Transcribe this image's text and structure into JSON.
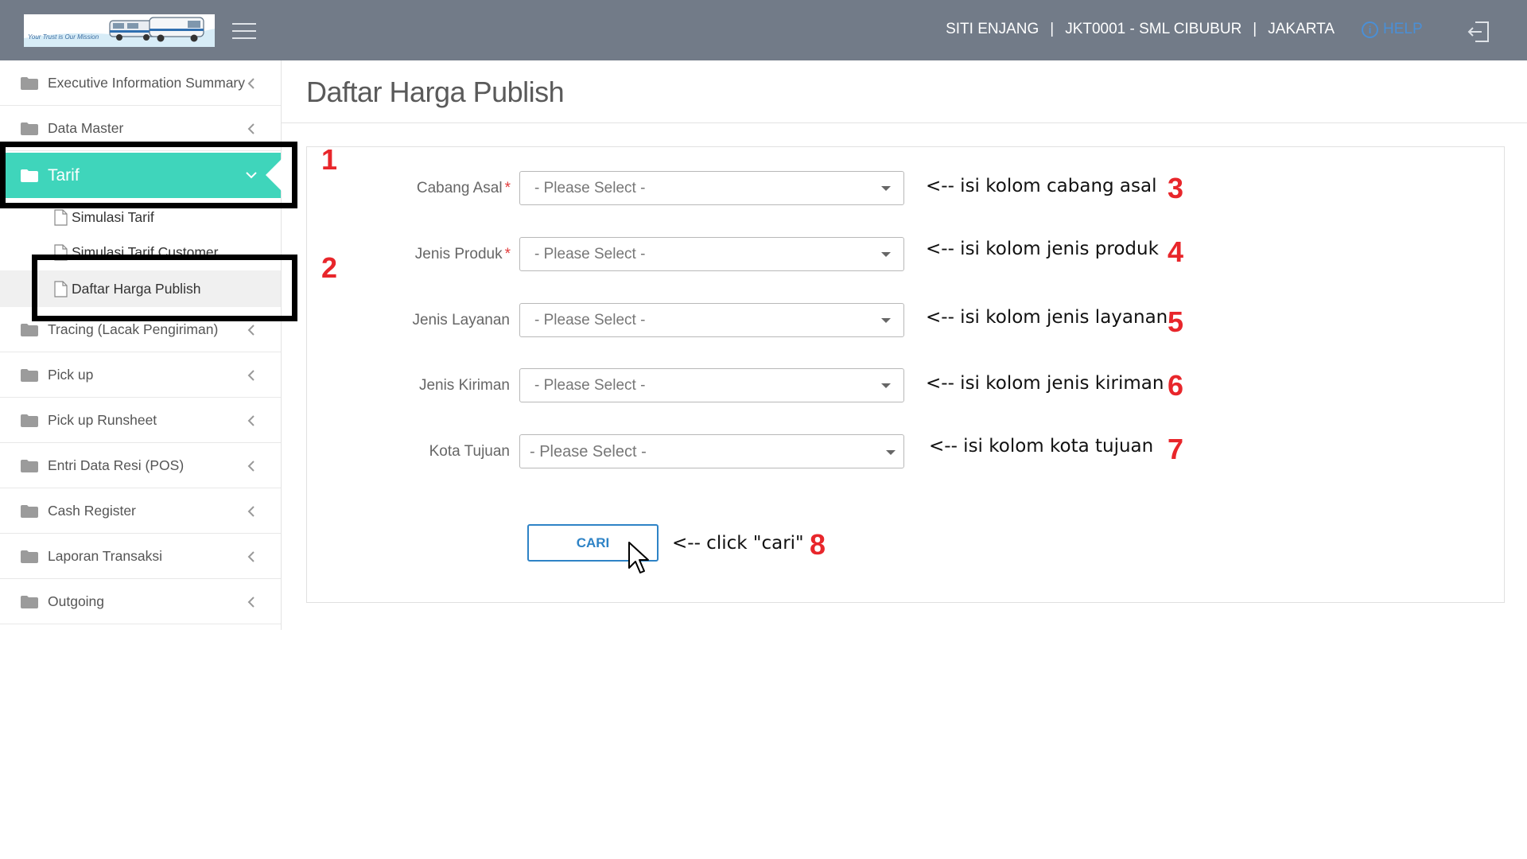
{
  "header": {
    "logo_tagline": "Your Trust is Our Mission",
    "user_name": "SITI ENJANG",
    "branch": "JKT0001 - SML CIBUBUR",
    "city": "JAKARTA",
    "separator": "|",
    "help_label": "HELP",
    "help_icon": "info-circle-icon",
    "logout_icon": "logout-icon"
  },
  "sidebar": {
    "items": [
      {
        "label": "Executive Information Summary"
      },
      {
        "label": "Data Master"
      },
      {
        "label": "Tarif"
      },
      {
        "label": "Tracing (Lacak Pengiriman)"
      },
      {
        "label": "Pick up"
      },
      {
        "label": "Pick up Runsheet"
      },
      {
        "label": "Entri Data Resi (POS)"
      },
      {
        "label": "Cash Register"
      },
      {
        "label": "Laporan Transaksi"
      },
      {
        "label": "Outgoing"
      }
    ],
    "tarif_children": [
      {
        "label": "Simulasi Tarif"
      },
      {
        "label": "Simulasi Tarif Customer"
      },
      {
        "label": "Daftar Harga Publish"
      }
    ],
    "active_color": "#3fd5bb"
  },
  "main": {
    "title": "Daftar Harga Publish",
    "form": {
      "fields": [
        {
          "label": "Cabang Asal",
          "required_mark": "*",
          "value": "- Please Select -"
        },
        {
          "label": "Jenis Produk",
          "required_mark": "*",
          "value": "- Please Select -"
        },
        {
          "label": "Jenis Layanan",
          "value": "- Please Select -"
        },
        {
          "label": "Jenis Kiriman",
          "value": "- Please Select -"
        },
        {
          "label": "Kota Tujuan",
          "value": "- Please Select -"
        }
      ],
      "submit_label": "CARI"
    }
  },
  "annotations": {
    "numbers": [
      "1",
      "2",
      "3",
      "4",
      "5",
      "6",
      "7",
      "8"
    ],
    "notes": [
      "<-- isi kolom cabang asal",
      "<-- isi kolom jenis produk",
      "<-- isi kolom jenis layanan",
      "<-- isi kolom jenis kiriman",
      "<-- isi kolom kota tujuan",
      "<-- click \"cari\""
    ],
    "number_color": "#e8262b"
  }
}
